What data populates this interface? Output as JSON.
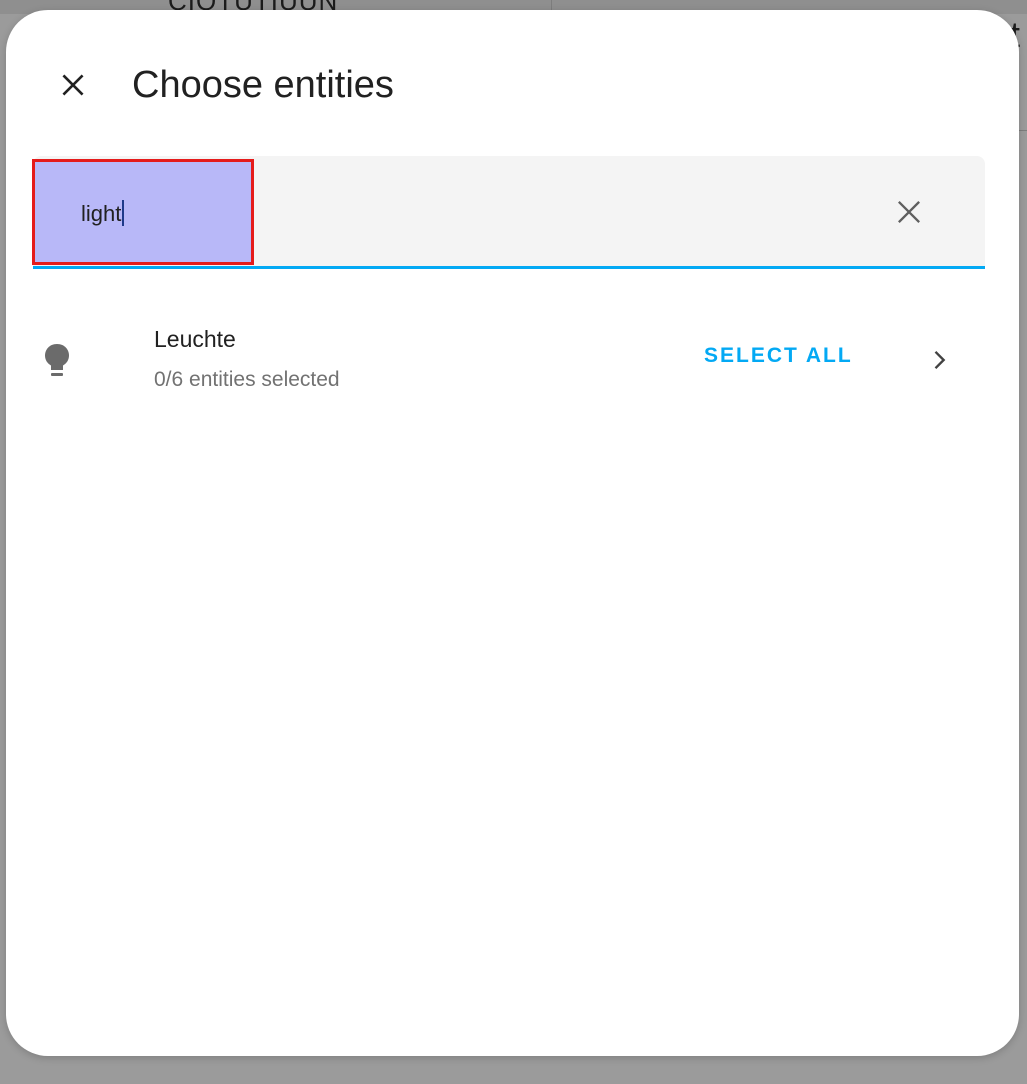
{
  "backdrop": {
    "left_text": "CIOTUTIUUN",
    "right_text": "ht"
  },
  "dialog": {
    "title": "Choose entities",
    "close_icon": "close-icon"
  },
  "search": {
    "value": "light",
    "placeholder": "",
    "clear_icon": "clear-icon",
    "accent_color": "#03a9f4",
    "highlight_color": "#b8b8f8",
    "highlight_border_color": "#e51b1b"
  },
  "list": {
    "items": [
      {
        "icon": "lightbulb-icon",
        "title": "Leuchte",
        "subtitle": "0/6 entities selected",
        "action_label": "SELECT ALL",
        "chevron_icon": "chevron-right-icon"
      }
    ]
  }
}
